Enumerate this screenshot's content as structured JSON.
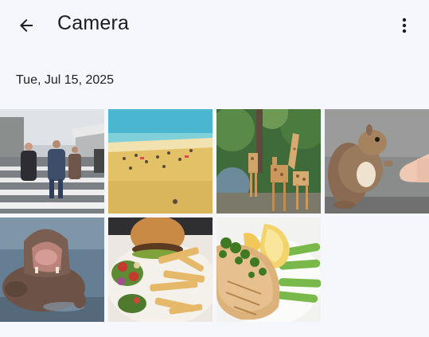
{
  "appbar": {
    "title": "Camera",
    "back_icon": "arrow-back-icon",
    "more_icon": "more-vert-icon"
  },
  "section": {
    "date": "Tue, Jul 15, 2025"
  },
  "photos": [
    {
      "subject": "street-crosswalk-people"
    },
    {
      "subject": "beach"
    },
    {
      "subject": "giraffes"
    },
    {
      "subject": "squirrel-hand"
    },
    {
      "subject": "hippo-water"
    },
    {
      "subject": "burger-fries"
    },
    {
      "subject": "salmon-asparagus-lemon"
    }
  ],
  "colors": {
    "background": "#f6f7fc",
    "text": "#1b1c20"
  }
}
